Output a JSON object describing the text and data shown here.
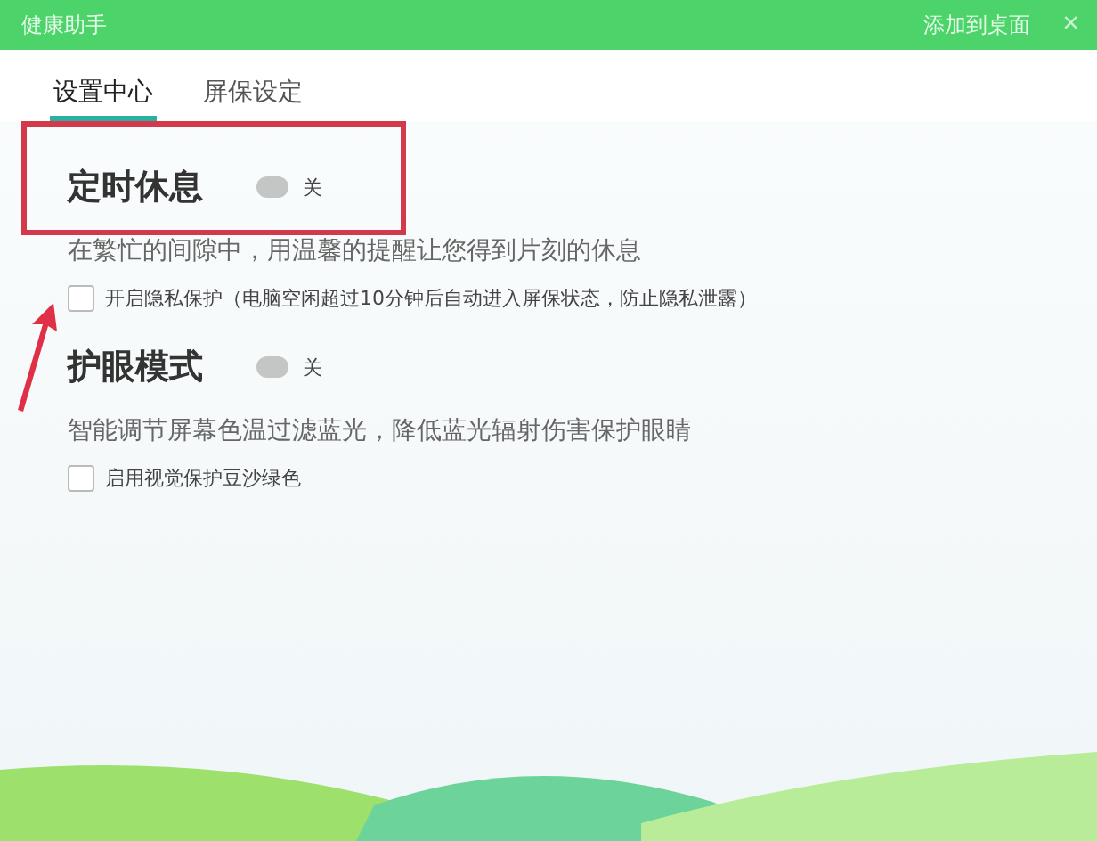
{
  "window": {
    "title": "健康助手",
    "action": "添加到桌面",
    "close": "×"
  },
  "tabs": [
    {
      "label": "设置中心",
      "selected": true
    },
    {
      "label": "屏保设定",
      "selected": false
    }
  ],
  "sections": [
    {
      "title": "定时休息",
      "on": false,
      "state_label": "关",
      "highlighted": true,
      "description": "在繁忙的间隙中，用温馨的提醒让您得到片刻的休息",
      "option": {
        "label": "开启隐私保护（电脑空闲超过10分钟后自动进入屏保状态，防止隐私泄露）",
        "checked": false
      }
    },
    {
      "title": "护眼模式",
      "on": false,
      "state_label": "关",
      "highlighted": false,
      "description": "智能调节屏幕色温过滤蓝光，降低蓝光辐射伤害保护眼睛",
      "option": {
        "label": "启用视觉保护豆沙绿色",
        "checked": false
      }
    }
  ]
}
